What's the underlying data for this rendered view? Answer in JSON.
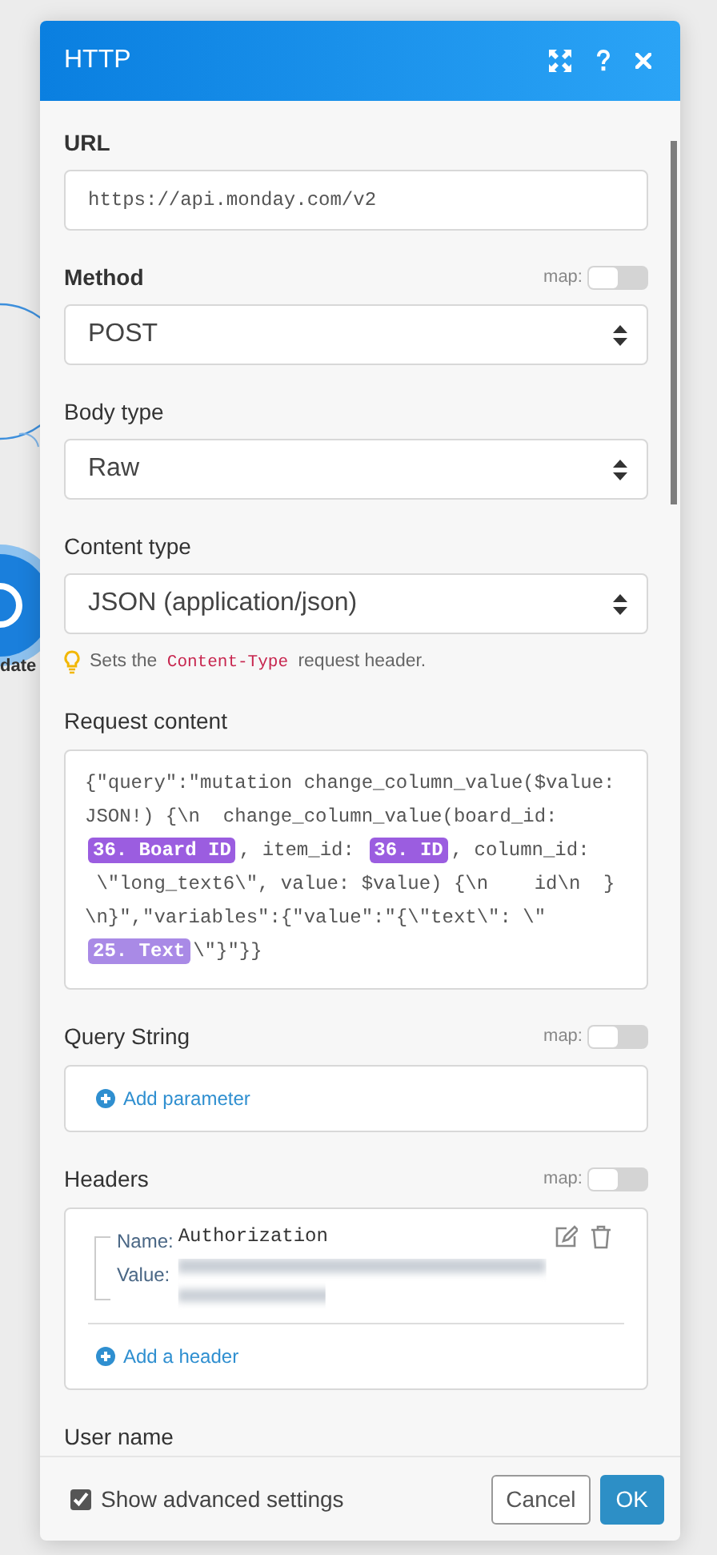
{
  "background": {
    "node_caption": "date"
  },
  "dialog": {
    "title": "HTTP"
  },
  "fields": [
    {
      "kind": "input",
      "label": "URL",
      "required": true,
      "value": "https://api.monday.com/v2"
    },
    {
      "kind": "select",
      "label": "Method",
      "required": true,
      "map": {
        "label": "map:",
        "on": false
      },
      "value": "POST"
    },
    {
      "kind": "select",
      "label": "Body type",
      "required": false,
      "value": "Raw"
    },
    {
      "kind": "select",
      "label": "Content type",
      "required": false,
      "value": "JSON (application/json)",
      "hint": {
        "before": "Sets the ",
        "code": "Content-Type",
        "after": " request header."
      }
    },
    {
      "kind": "code",
      "label": "Request content",
      "required": false,
      "lines": [
        [
          {
            "kind": "text",
            "text": "{\"query\":\"mutation change_column_value($value:"
          }
        ],
        [
          {
            "kind": "text",
            "text": "JSON!) {\\n  change_column_value(board_id:"
          }
        ],
        [
          {
            "kind": "pill",
            "text": "36. Board ID",
            "color": "#9b5de0"
          },
          {
            "kind": "text",
            "text": ", item_id: "
          },
          {
            "kind": "pill",
            "text": "36. ID",
            "color": "#9b5de0"
          },
          {
            "kind": "text",
            "text": ", column_id:"
          }
        ],
        [
          {
            "kind": "text",
            "text": " \\\"long_text6\\\", value: $value) {\\n    id\\n  }"
          }
        ],
        [
          {
            "kind": "text",
            "text": "\\n}\",\"variables\":{\"value\":\"{\\\"text\\\": \\\""
          }
        ],
        [
          {
            "kind": "pill",
            "text": "25. Text",
            "color": "#a98ae6"
          },
          {
            "kind": "text",
            "text": "\\\"}\"}}"
          }
        ]
      ]
    },
    {
      "kind": "params",
      "label": "Query String",
      "required": false,
      "map": {
        "label": "map:",
        "on": false
      },
      "add_label": "Add parameter"
    },
    {
      "kind": "headers",
      "label": "Headers",
      "required": false,
      "map": {
        "label": "map:",
        "on": false
      },
      "items": [
        {
          "name_label": "Name:",
          "name": "Authorization",
          "value_label": "Value:"
        }
      ],
      "add_label": "Add a header"
    },
    {
      "kind": "label",
      "label": "User name",
      "required": false
    }
  ],
  "footer": {
    "advanced": {
      "label": "Show advanced settings",
      "checked": true
    },
    "buttons": [
      {
        "label": "Cancel",
        "primary": false
      },
      {
        "label": "OK",
        "primary": true
      }
    ]
  }
}
